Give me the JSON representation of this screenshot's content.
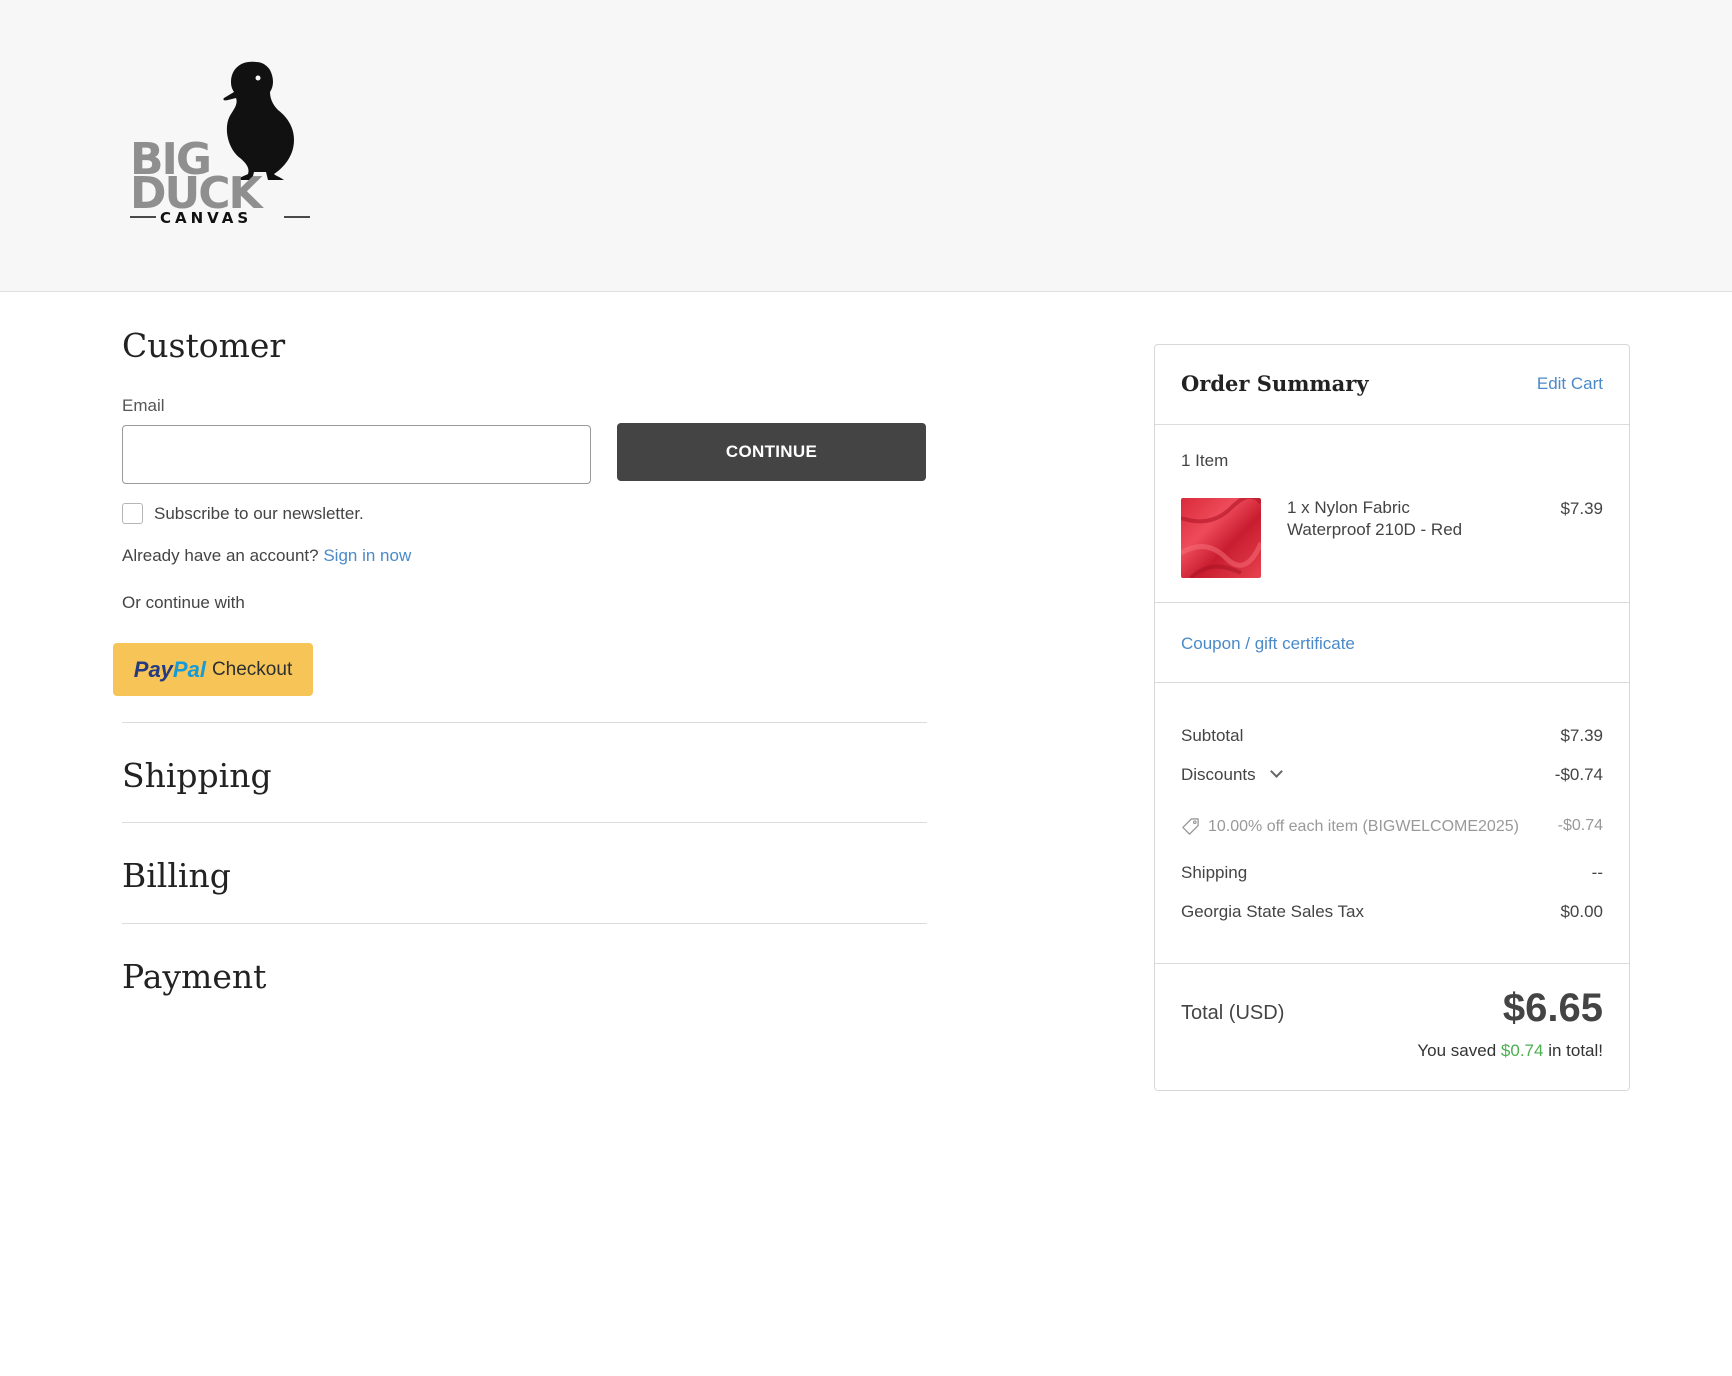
{
  "brand": {
    "logo_text_top": "BIG",
    "logo_text_mid": "DUCK",
    "logo_text_bottom": "CANVAS"
  },
  "customer": {
    "title": "Customer",
    "email_label": "Email",
    "email_value": "",
    "continue_label": "CONTINUE",
    "newsletter_label": "Subscribe to our newsletter.",
    "account_prompt": "Already have an account?",
    "sign_in_label": "Sign in now",
    "or_continue": "Or continue with",
    "paypal_pay": "Pay",
    "paypal_pal": "Pal",
    "paypal_checkout": "Checkout"
  },
  "sections": {
    "shipping": "Shipping",
    "billing": "Billing",
    "payment": "Payment"
  },
  "summary": {
    "title": "Order Summary",
    "edit_cart": "Edit Cart",
    "items_count": "1 Item",
    "product": {
      "name": "1 x Nylon Fabric Waterproof 210D - Red",
      "price": "$7.39",
      "color": "#d92a3a"
    },
    "coupon_label": "Coupon / gift certificate",
    "subtotal_label": "Subtotal",
    "subtotal_value": "$7.39",
    "discounts_label": "Discounts",
    "discounts_value": "-$0.74",
    "discount_detail_label": "10.00% off each item (BIGWELCOME2025)",
    "discount_detail_value": "-$0.74",
    "shipping_label": "Shipping",
    "shipping_value": "--",
    "tax_label": "Georgia State Sales Tax",
    "tax_value": "$0.00",
    "total_label": "Total (USD)",
    "total_value": "$6.65",
    "saved_prefix": "You saved",
    "saved_amount": "$0.74",
    "saved_suffix": "in total!"
  },
  "colors": {
    "link": "#4a8ac9",
    "button_dark": "#444444",
    "paypal_yellow": "#f7c557",
    "saved_green": "#4caf50"
  }
}
